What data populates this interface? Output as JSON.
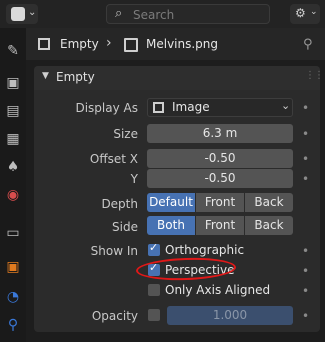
{
  "topbar": {
    "editor_type_icon": "properties-grid-icon",
    "search_placeholder": "Search",
    "options_icon": "filter-icon"
  },
  "tabs": [
    {
      "name": "tool-tab",
      "icon": "wrench-screwdriver-icon",
      "color": "#bdbdbd"
    },
    {
      "name": "render-tab",
      "icon": "camera-back-icon",
      "color": "#bdbdbd"
    },
    {
      "name": "output-tab",
      "icon": "printer-icon",
      "color": "#bdbdbd"
    },
    {
      "name": "view-layer-tab",
      "icon": "image-stack-icon",
      "color": "#bdbdbd"
    },
    {
      "name": "scene-tab",
      "icon": "scene-icon",
      "color": "#bdbdbd"
    },
    {
      "name": "world-tab",
      "icon": "world-icon",
      "color": "#d84d4d"
    },
    {
      "name": "collection-tab",
      "icon": "collection-box-icon",
      "color": "#bdbdbd"
    },
    {
      "name": "object-tab",
      "icon": "object-square-icon",
      "color": "#e07a1f"
    },
    {
      "name": "physics-tab",
      "icon": "physics-icon",
      "color": "#3a78d8"
    },
    {
      "name": "constraints-tab",
      "icon": "constraint-icon",
      "color": "#3a78d8"
    }
  ],
  "header": {
    "object_name": "Empty",
    "separator": "›",
    "data_name": "Melvins.png"
  },
  "panel": {
    "title": "Empty",
    "display_as": {
      "label": "Display As",
      "value": "Image"
    },
    "size": {
      "label": "Size",
      "value": "6.3 m"
    },
    "offset_x": {
      "label": "Offset X",
      "value": "-0.50"
    },
    "offset_y": {
      "label": "Y",
      "value": "-0.50"
    },
    "depth": {
      "label": "Depth",
      "options": [
        "Default",
        "Front",
        "Back"
      ],
      "selected": "Default"
    },
    "side": {
      "label": "Side",
      "options": [
        "Both",
        "Front",
        "Back"
      ],
      "selected": "Both"
    },
    "show_in": {
      "label": "Show In",
      "orthographic": {
        "label": "Orthographic",
        "checked": true
      },
      "perspective": {
        "label": "Perspective",
        "checked": true
      },
      "only_axis_aligned": {
        "label": "Only Axis Aligned",
        "checked": false
      }
    },
    "opacity": {
      "label": "Opacity",
      "value": "1.000",
      "enabled": false
    }
  },
  "colors": {
    "accent": "#4772b3",
    "annotation": "#e01818"
  }
}
